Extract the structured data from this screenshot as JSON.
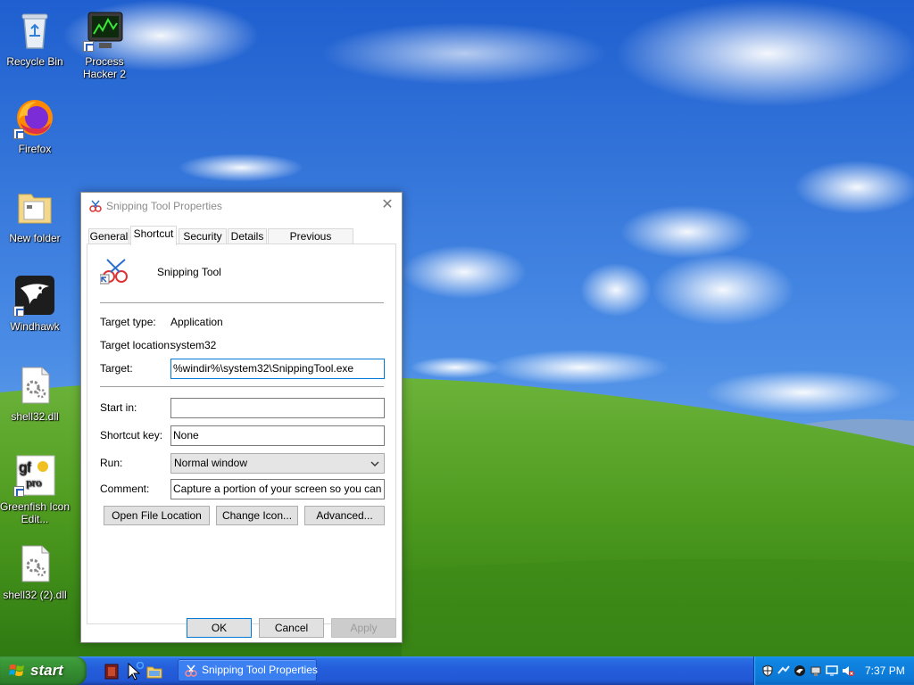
{
  "desktop": {
    "icons": [
      {
        "label": "Recycle Bin"
      },
      {
        "label": "Process Hacker 2"
      },
      {
        "label": "Firefox"
      },
      {
        "label": "New folder"
      },
      {
        "label": "Windhawk"
      },
      {
        "label": "shell32.dll"
      },
      {
        "label": "Greenfish Icon Edit..."
      },
      {
        "label": "shell32 (2).dll"
      }
    ]
  },
  "dialog": {
    "title": "Snipping Tool Properties",
    "close_glyph": "✕",
    "tabs": [
      {
        "label": "General"
      },
      {
        "label": "Shortcut"
      },
      {
        "label": "Security"
      },
      {
        "label": "Details"
      },
      {
        "label": "Previous Versions"
      }
    ],
    "active_tab": "Shortcut",
    "shortcut": {
      "name": "Snipping Tool",
      "target_type_label": "Target type:",
      "target_type_value": "Application",
      "target_location_label": "Target location:",
      "target_location_value": "system32",
      "target_label": "Target:",
      "target_value": "%windir%\\system32\\SnippingTool.exe",
      "start_in_label": "Start in:",
      "start_in_value": "",
      "shortcut_key_label": "Shortcut key:",
      "shortcut_key_value": "None",
      "run_label": "Run:",
      "run_value": "Normal window",
      "comment_label": "Comment:",
      "comment_value": "Capture a portion of your screen so you can save,",
      "open_file_location": "Open File Location",
      "change_icon": "Change Icon...",
      "advanced": "Advanced..."
    },
    "ok_label": "OK",
    "cancel_label": "Cancel",
    "apply_label": "Apply"
  },
  "taskbar": {
    "start_label": "start",
    "task_title": "Snipping Tool Properties",
    "clock": "7:37 PM"
  },
  "colors": {
    "taskbar_blue": "#245edb",
    "start_green": "#3c9a39",
    "tray_blue": "#0f84e0",
    "sky": "#2f6fd3",
    "grass": "#4f9a1f"
  }
}
